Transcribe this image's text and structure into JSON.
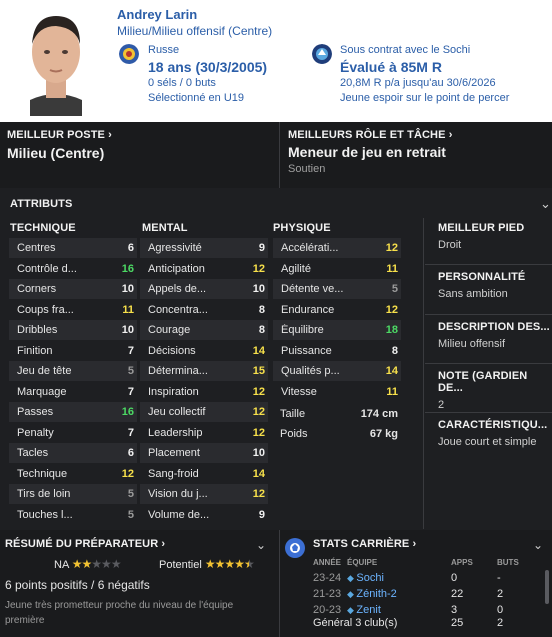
{
  "header": {
    "name": "Andrey Larin",
    "position": "Milieu/Milieu offensif (Centre)",
    "nationality": "Russe",
    "age": "18 ans (30/3/2005)",
    "caps": "0 séls / 0 buts",
    "selection": "Sélectionné en U19",
    "contract": "Sous contrat avec le Sochi",
    "value": "Évalué à 85M R",
    "wage": "20,8M R p/a jusqu'au 30/6/2026",
    "status": "Jeune espoir sur le point de percer"
  },
  "best_position": {
    "caption": "MEILLEUR POSTE",
    "value": "Milieu (Centre)"
  },
  "best_role": {
    "caption": "MEILLEURS RÔLE ET TÂCHE",
    "value": "Meneur de jeu en retrait",
    "duty": "Soutien"
  },
  "attributes": {
    "title": "ATTRIBUTS",
    "technique": {
      "title": "TECHNIQUE",
      "items": [
        {
          "name": "Centres",
          "value": "6"
        },
        {
          "name": "Contrôle d...",
          "value": "16"
        },
        {
          "name": "Corners",
          "value": "10"
        },
        {
          "name": "Coups fra...",
          "value": "11"
        },
        {
          "name": "Dribbles",
          "value": "10"
        },
        {
          "name": "Finition",
          "value": "7"
        },
        {
          "name": "Jeu de tête",
          "value": "5"
        },
        {
          "name": "Marquage",
          "value": "7"
        },
        {
          "name": "Passes",
          "value": "16"
        },
        {
          "name": "Penalty",
          "value": "7"
        },
        {
          "name": "Tacles",
          "value": "6"
        },
        {
          "name": "Technique",
          "value": "12"
        },
        {
          "name": "Tirs de loin",
          "value": "5"
        },
        {
          "name": "Touches l...",
          "value": "5"
        }
      ]
    },
    "mental": {
      "title": "MENTAL",
      "items": [
        {
          "name": "Agressivité",
          "value": "9"
        },
        {
          "name": "Anticipation",
          "value": "12"
        },
        {
          "name": "Appels de...",
          "value": "10"
        },
        {
          "name": "Concentra...",
          "value": "8"
        },
        {
          "name": "Courage",
          "value": "8"
        },
        {
          "name": "Décisions",
          "value": "14"
        },
        {
          "name": "Détermina...",
          "value": "15"
        },
        {
          "name": "Inspiration",
          "value": "12"
        },
        {
          "name": "Jeu collectif",
          "value": "12"
        },
        {
          "name": "Leadership",
          "value": "12"
        },
        {
          "name": "Placement",
          "value": "10"
        },
        {
          "name": "Sang-froid",
          "value": "14"
        },
        {
          "name": "Vision du j...",
          "value": "12"
        },
        {
          "name": "Volume de...",
          "value": "9"
        }
      ]
    },
    "physique": {
      "title": "PHYSIQUE",
      "items": [
        {
          "name": "Accélérati...",
          "value": "12"
        },
        {
          "name": "Agilité",
          "value": "11"
        },
        {
          "name": "Détente ve...",
          "value": "5"
        },
        {
          "name": "Endurance",
          "value": "12"
        },
        {
          "name": "Équilibre",
          "value": "18"
        },
        {
          "name": "Puissance",
          "value": "8"
        },
        {
          "name": "Qualités p...",
          "value": "14"
        },
        {
          "name": "Vitesse",
          "value": "11"
        }
      ],
      "height_label": "Taille",
      "height": "174 cm",
      "weight_label": "Poids",
      "weight": "67 kg"
    }
  },
  "side": {
    "best_foot_cap": "MEILLEUR PIED",
    "best_foot": "Droit",
    "personality_cap": "PERSONNALITÉ",
    "personality": "Sans ambition",
    "description_cap": "DESCRIPTION DES...",
    "description": "Milieu offensif",
    "gk_rating_cap": "NOTE (GARDIEN DE...",
    "gk_rating": "2",
    "traits_cap": "CARACTÉRISTIQU...",
    "traits": "Joue court et simple"
  },
  "coach": {
    "caption": "RÉSUMÉ DU PRÉPARATEUR",
    "current_label": "NA",
    "current_stars": 2,
    "potential_label": "Potentiel",
    "potential_stars": 4.5,
    "summary": "6 points positifs / 6 négatifs",
    "note": "Jeune très prometteur proche du niveau de l'équipe première"
  },
  "career": {
    "caption": "STATS CARRIÈRE",
    "headers": [
      "ANNÉE",
      "ÉQUIPE",
      "APPS",
      "BUTS"
    ],
    "rows": [
      {
        "year": "23-24",
        "team": "Sochi",
        "apps": "0",
        "goals": "-"
      },
      {
        "year": "21-23",
        "team": "Zénith-2",
        "apps": "22",
        "goals": "2"
      },
      {
        "year": "20-23",
        "team": "Zenit",
        "apps": "3",
        "goals": "0"
      }
    ],
    "total_label": "Général 3 club(s)",
    "total_apps": "25",
    "total_goals": "2"
  },
  "colors": {
    "link_blue": "#2b5ea8",
    "good": "#4cd964",
    "mid": "#f7e04b",
    "low": "#9a9a9a"
  }
}
